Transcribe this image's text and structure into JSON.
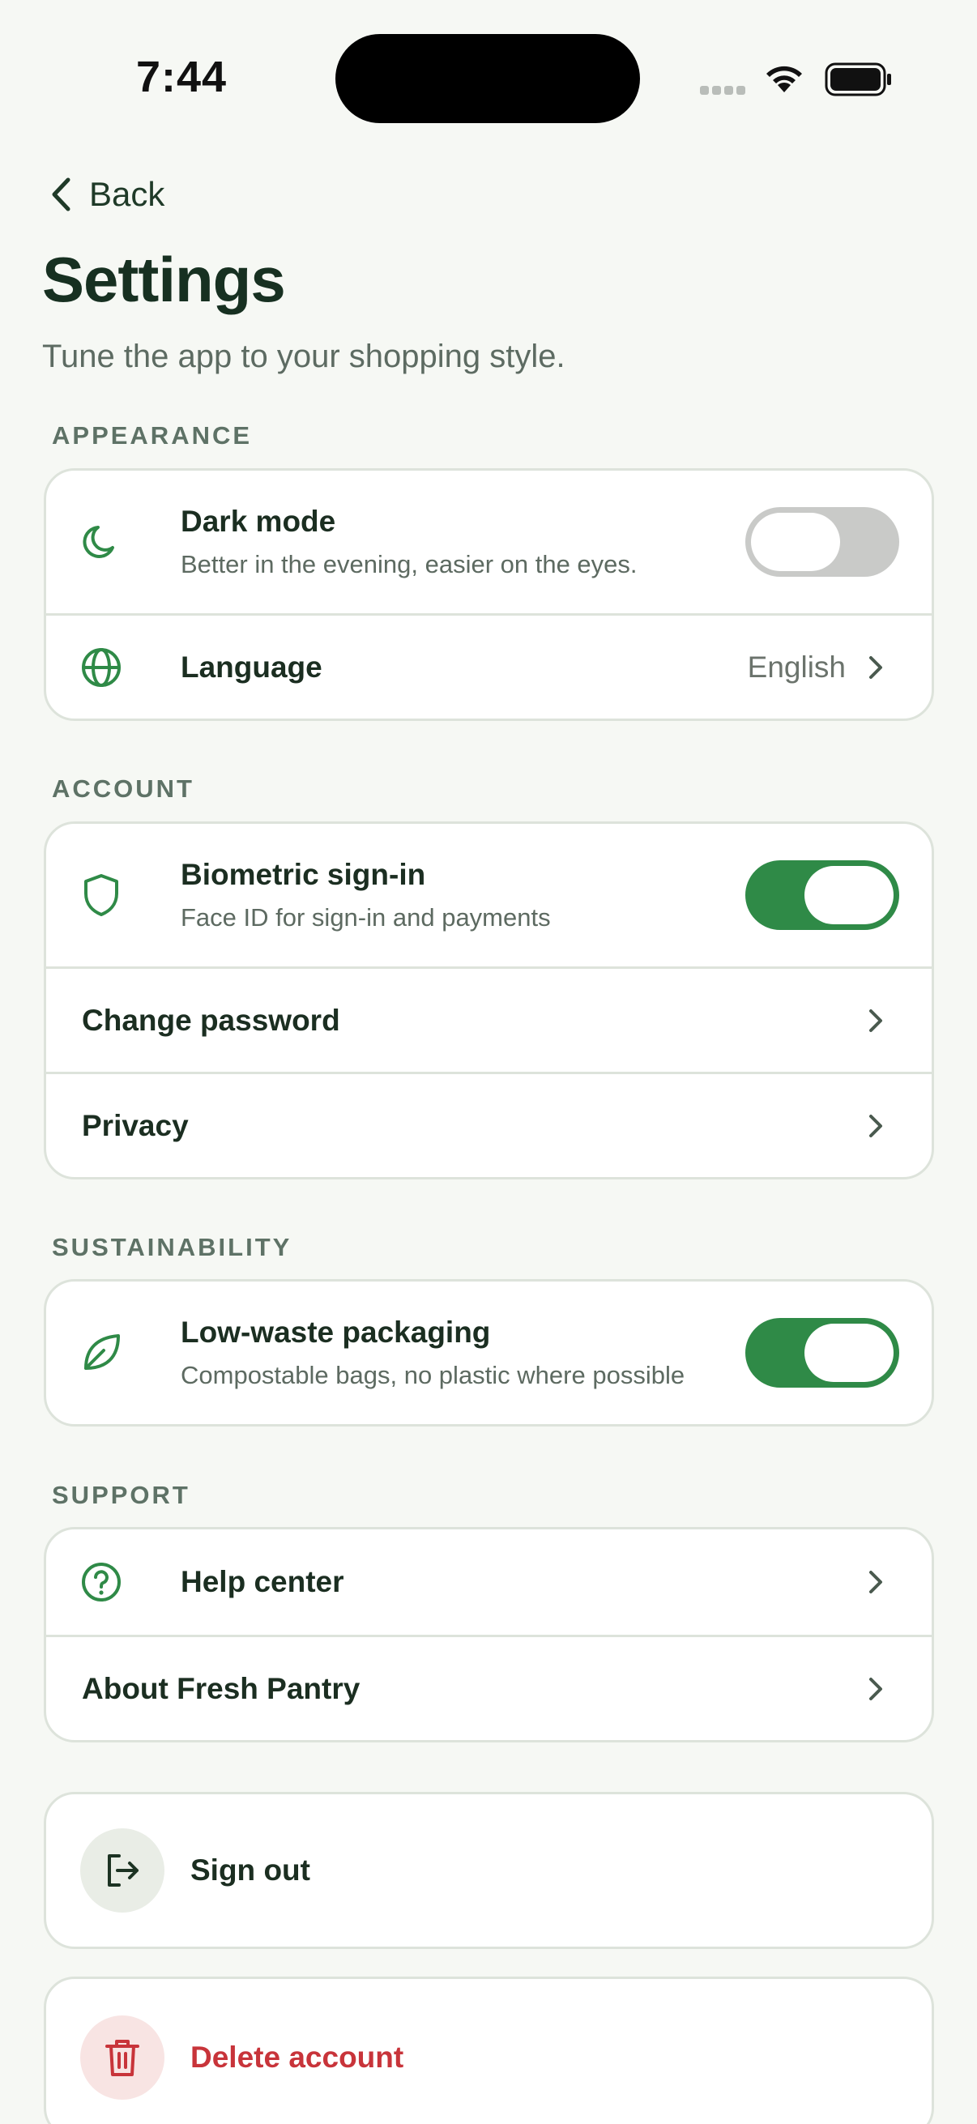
{
  "status": {
    "time": "7:44"
  },
  "nav": {
    "back_label": "Back"
  },
  "header": {
    "title": "Settings",
    "subtitle": "Tune the app to your shopping style."
  },
  "sections": {
    "appearance": {
      "label": "APPEARANCE",
      "dark_mode": {
        "title": "Dark mode",
        "subtitle": "Better in the evening, easier on the eyes.",
        "enabled": false
      },
      "language": {
        "title": "Language",
        "value": "English"
      }
    },
    "account": {
      "label": "ACCOUNT",
      "biometric": {
        "title": "Biometric sign-in",
        "subtitle": "Face ID for sign-in and payments",
        "enabled": true
      },
      "change_password": {
        "title": "Change password"
      },
      "privacy": {
        "title": "Privacy"
      }
    },
    "sustainability": {
      "label": "SUSTAINABILITY",
      "low_waste": {
        "title": "Low-waste packaging",
        "subtitle": "Compostable bags, no plastic where possible",
        "enabled": true
      }
    },
    "support": {
      "label": "SUPPORT",
      "help": {
        "title": "Help center"
      },
      "about": {
        "title": "About Fresh Pantry"
      }
    }
  },
  "actions": {
    "sign_out": "Sign out",
    "delete_account": "Delete account"
  },
  "colors": {
    "accent": "#2f8a47",
    "danger": "#c8343a",
    "background": "#f6f8f4"
  }
}
